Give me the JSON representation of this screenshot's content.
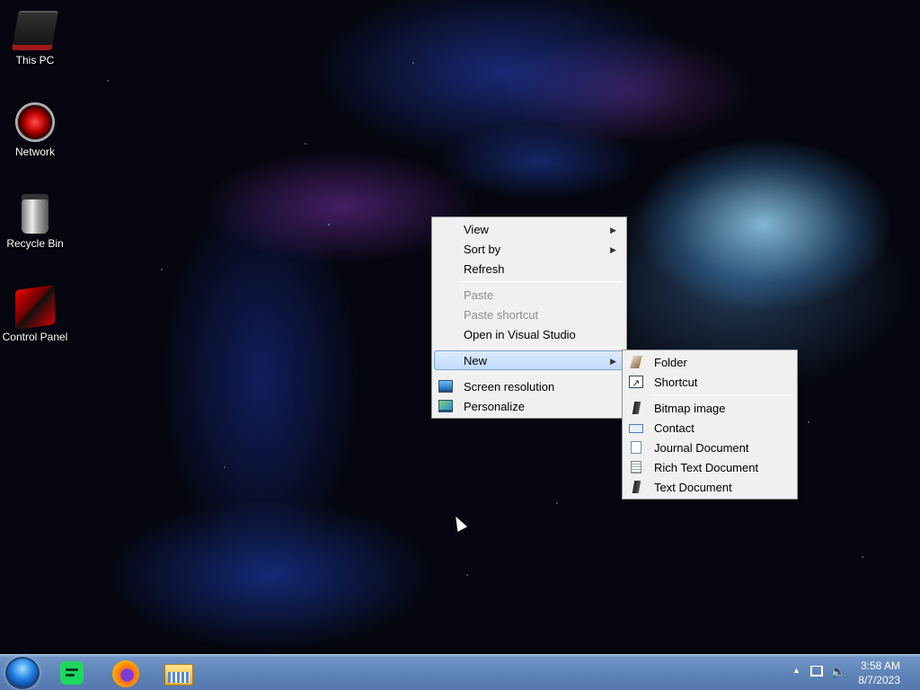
{
  "desktop": {
    "icons": [
      {
        "label": "This PC",
        "icon": "this-pc-icon"
      },
      {
        "label": "Network",
        "icon": "network-icon"
      },
      {
        "label": "Recycle Bin",
        "icon": "recycle-bin-icon"
      },
      {
        "label": "Control Panel",
        "icon": "control-panel-icon"
      }
    ]
  },
  "context_menu": {
    "items": [
      {
        "label": "View",
        "submenu": true
      },
      {
        "label": "Sort by",
        "submenu": true
      },
      {
        "label": "Refresh"
      },
      {
        "label": "Paste",
        "disabled": true
      },
      {
        "label": "Paste shortcut",
        "disabled": true
      },
      {
        "label": "Open in Visual Studio"
      },
      {
        "label": "New",
        "submenu": true,
        "highlighted": true
      },
      {
        "label": "Screen resolution",
        "icon": "screen-resolution-icon"
      },
      {
        "label": "Personalize",
        "icon": "personalize-icon"
      }
    ]
  },
  "new_submenu": {
    "items": [
      {
        "label": "Folder",
        "icon": "folder-icon"
      },
      {
        "label": "Shortcut",
        "icon": "shortcut-icon"
      },
      {
        "label": "Bitmap image",
        "icon": "bitmap-icon"
      },
      {
        "label": "Contact",
        "icon": "contact-icon"
      },
      {
        "label": "Journal Document",
        "icon": "journal-icon"
      },
      {
        "label": "Rich Text Document",
        "icon": "rich-text-icon"
      },
      {
        "label": "Text Document",
        "icon": "text-document-icon"
      }
    ]
  },
  "taskbar": {
    "apps": [
      "start-orb",
      "spotify-icon",
      "firefox-icon",
      "file-explorer-icon"
    ],
    "clock": {
      "time": "3:58 AM",
      "date": "8/7/2023"
    }
  },
  "colors": {
    "menu_bg": "#f0f0f0",
    "menu_highlight": "#c1dbfc",
    "taskbar": "#5d82b6"
  }
}
